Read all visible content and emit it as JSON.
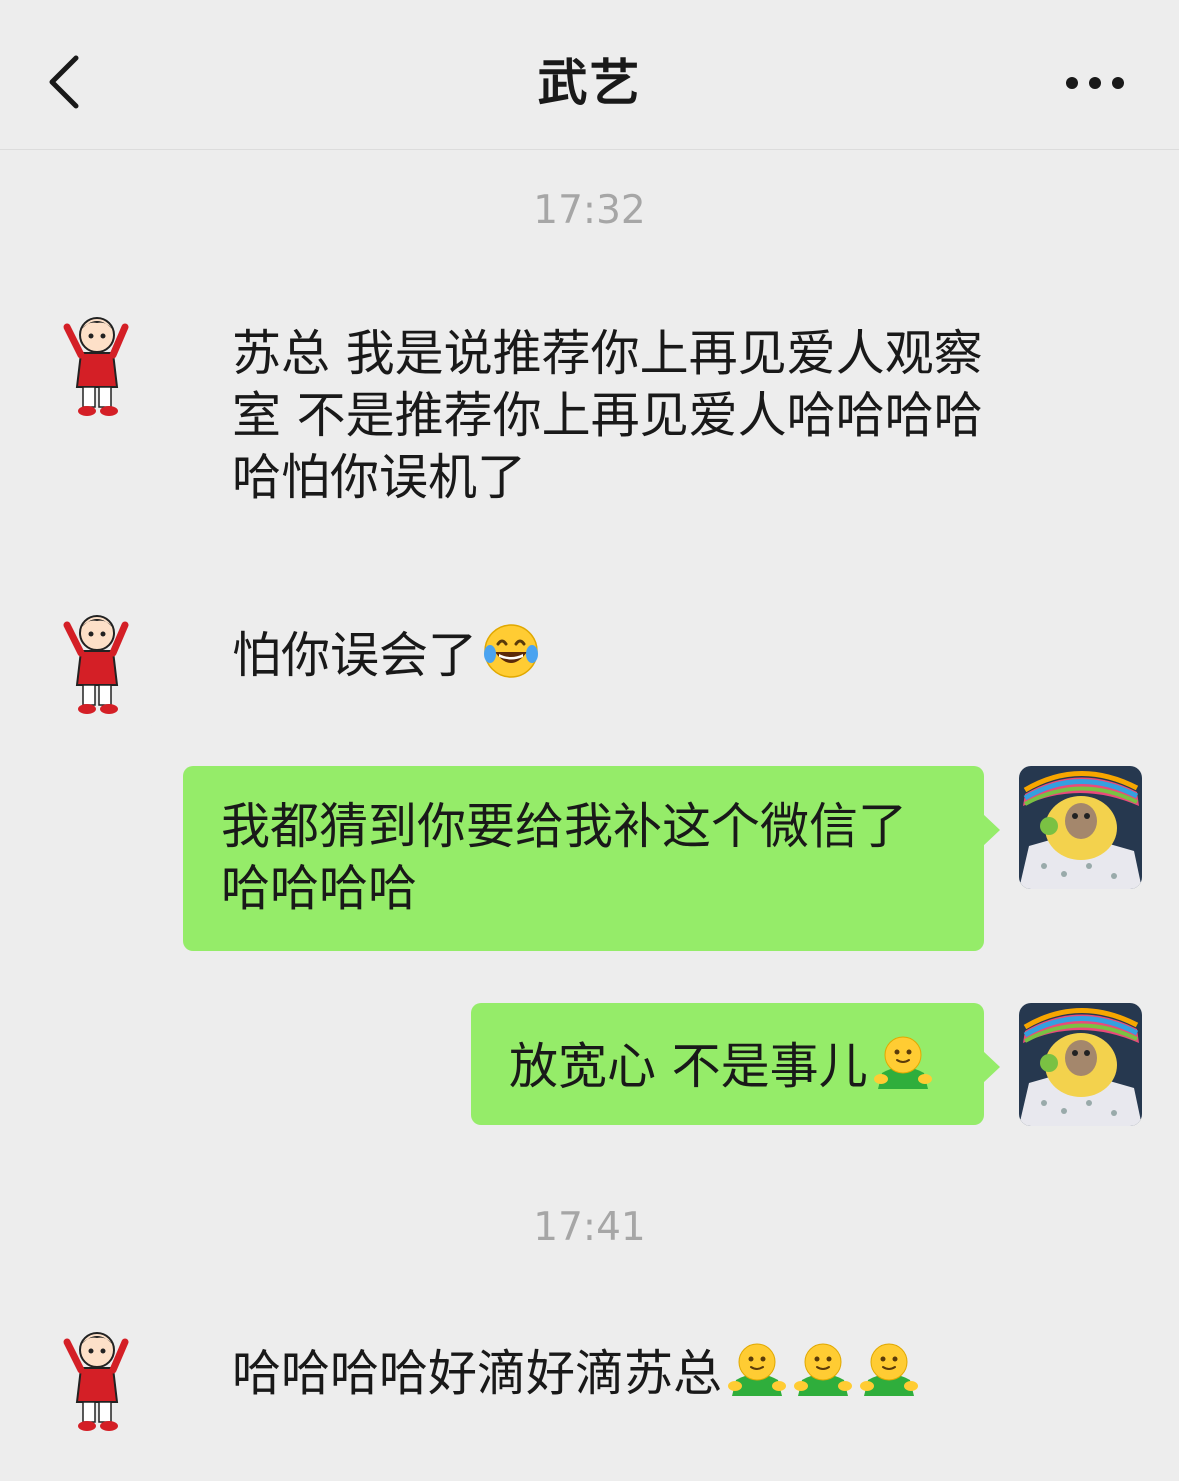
{
  "header": {
    "title": "武艺",
    "back_icon": "chevron-left-icon",
    "more_icon": "more-dots-icon"
  },
  "colors": {
    "background": "#ededed",
    "outgoing_bubble": "#95ec69",
    "timestamp": "#a6a6a6"
  },
  "timestamps": [
    "17:32",
    "17:41"
  ],
  "messages": [
    {
      "side": "left",
      "text": "苏总 我是说推荐你上再见爱人观察室 不是推荐你上再见爱人哈哈哈哈哈怕你误机了"
    },
    {
      "side": "left",
      "text": "怕你误会了",
      "emoji": "laughing-tears-emoji"
    },
    {
      "side": "right",
      "text": "我都猜到你要给我补这个微信了哈哈哈哈"
    },
    {
      "side": "right",
      "text": "放宽心 不是事儿",
      "emoji": "green-buddy-emoji"
    },
    {
      "side": "left",
      "text": "哈哈哈哈好滴好滴苏总",
      "emoji": "green-buddy-emoji x3"
    }
  ]
}
